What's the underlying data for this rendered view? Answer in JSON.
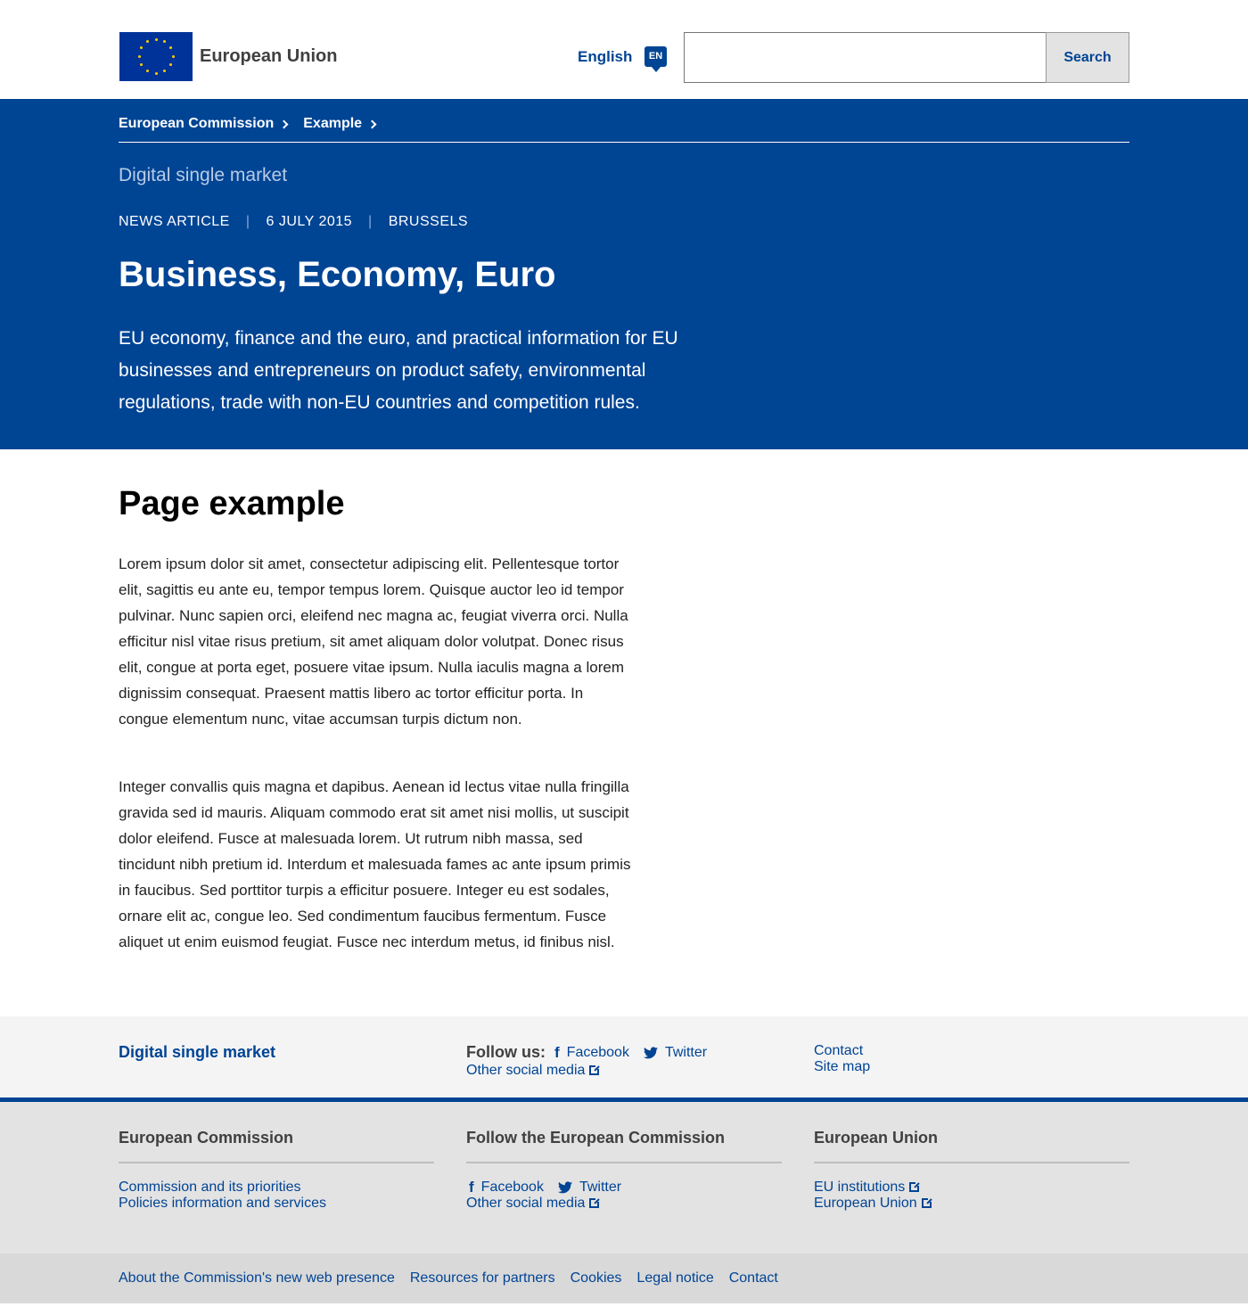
{
  "header": {
    "site_name": "European Union",
    "language": "English",
    "language_code": "EN",
    "search_button": "Search",
    "search_value": ""
  },
  "banner": {
    "breadcrumbs": [
      "European Commission",
      "Example"
    ],
    "site_title": "Digital single market",
    "meta": [
      "NEWS ARTICLE",
      "6 JULY 2015",
      "BRUSSELS"
    ],
    "title": "Business, Economy, Euro",
    "intro": "EU economy, finance and the euro, and practical information for EU businesses and entrepreneurs on product safety, environmental regulations, trade with non-EU countries and competition rules."
  },
  "main": {
    "heading": "Page example",
    "paragraphs": [
      "Lorem ipsum dolor sit amet, consectetur adipiscing elit. Pellentesque tortor elit, sagittis eu ante eu, tempor tempus lorem. Quisque auctor leo id tempor pulvinar. Nunc sapien orci, eleifend nec magna ac, feugiat viverra orci. Nulla efficitur nisl vitae risus pretium, sit amet aliquam dolor volutpat. Donec risus elit, congue at porta eget, posuere vitae ipsum. Nulla iaculis magna a lorem dignissim consequat. Praesent mattis libero ac tortor efficitur porta. In congue elementum nunc, vitae accumsan turpis dictum non.",
      "Integer convallis quis magna et dapibus. Aenean id lectus vitae nulla fringilla gravida sed id mauris. Aliquam commodo erat sit amet nisi mollis, ut suscipit dolor eleifend. Fusce at malesuada lorem. Ut rutrum nibh massa, sed tincidunt nibh pretium id. Interdum et malesuada fames ac ante ipsum primis in faucibus. Sed porttitor turpis a efficitur posuere. Integer eu est sodales, ornare elit ac, congue leo. Sed condimentum faucibus fermentum. Fusce aliquet ut enim euismod feugiat. Fusce nec interdum metus, id finibus nisl."
    ]
  },
  "footer_site": {
    "title": "Digital single market",
    "follow_label": "Follow us:",
    "facebook": "Facebook",
    "twitter": "Twitter",
    "other_social": "Other social media",
    "contact": "Contact",
    "site_map": "Site map"
  },
  "footer_corporate": {
    "col1": {
      "title": "European Commission",
      "links": [
        "Commission and its priorities",
        "Policies information and services"
      ]
    },
    "col2": {
      "title": "Follow the European Commission",
      "facebook": "Facebook",
      "twitter": "Twitter",
      "other_social": "Other social media"
    },
    "col3": {
      "title": "European Union",
      "links": [
        "EU institutions",
        "European Union"
      ]
    }
  },
  "footer_bottom": {
    "links": [
      "About the Commission's new web presence",
      "Resources for partners",
      "Cookies",
      "Legal notice",
      "Contact"
    ]
  },
  "colors": {
    "primary_blue": "#004494",
    "flag_blue": "#003399",
    "flag_gold": "#ffcc00"
  }
}
